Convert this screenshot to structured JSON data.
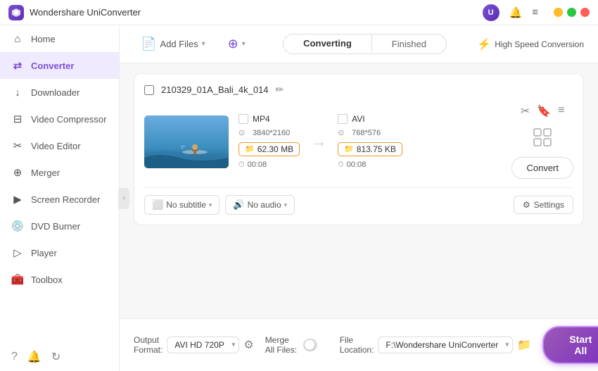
{
  "app": {
    "title": "Wondershare UniConverter",
    "logo_initials": "W"
  },
  "titlebar": {
    "user_icon": "👤",
    "bell_label": "🔔",
    "menu_label": "≡",
    "min_label": "—",
    "max_label": "□",
    "close_label": "✕"
  },
  "sidebar": {
    "items": [
      {
        "id": "home",
        "label": "Home",
        "icon": "⌂"
      },
      {
        "id": "converter",
        "label": "Converter",
        "icon": "⇄",
        "active": true
      },
      {
        "id": "downloader",
        "label": "Downloader",
        "icon": "↓"
      },
      {
        "id": "video-compressor",
        "label": "Video Compressor",
        "icon": "⊟"
      },
      {
        "id": "video-editor",
        "label": "Video Editor",
        "icon": "✂"
      },
      {
        "id": "merger",
        "label": "Merger",
        "icon": "⊕"
      },
      {
        "id": "screen-recorder",
        "label": "Screen Recorder",
        "icon": "▶"
      },
      {
        "id": "dvd-burner",
        "label": "DVD Burner",
        "icon": "💿"
      },
      {
        "id": "player",
        "label": "Player",
        "icon": "▷"
      },
      {
        "id": "toolbox",
        "label": "Toolbox",
        "icon": "🧰"
      }
    ],
    "footer_icons": [
      "?",
      "🔔",
      "↻"
    ]
  },
  "toolbar": {
    "add_files_label": "Add Files",
    "add_files_icon": "📄",
    "add_more_label": "",
    "add_more_icon": "⊕"
  },
  "tabs": {
    "converting_label": "Converting",
    "finished_label": "Finished"
  },
  "speed": {
    "label": "High Speed Conversion",
    "icon": "⚡"
  },
  "file": {
    "name": "210329_01A_Bali_4k_014",
    "edit_icon": "✏",
    "source": {
      "format": "MP4",
      "resolution": "3840*2160",
      "size": "62.30 MB",
      "duration": "00:08"
    },
    "target": {
      "format": "AVI",
      "resolution": "768*576",
      "size": "813.75 KB",
      "duration": "00:08"
    },
    "subtitle_label": "No subtitle",
    "audio_label": "No audio",
    "settings_label": "Settings",
    "convert_btn_label": "Convert"
  },
  "bottom_bar": {
    "output_format_label": "Output Format:",
    "output_format_value": "AVI HD 720P",
    "merge_label": "Merge All Files:",
    "file_location_label": "File Location:",
    "file_location_value": "F:\\Wondershare UniConverter",
    "start_all_label": "Start All"
  },
  "colors": {
    "accent": "#7b4fd4",
    "accent_light": "#f0eaff",
    "orange_border": "#e8972b",
    "start_btn_bg": "#9b59b6"
  }
}
